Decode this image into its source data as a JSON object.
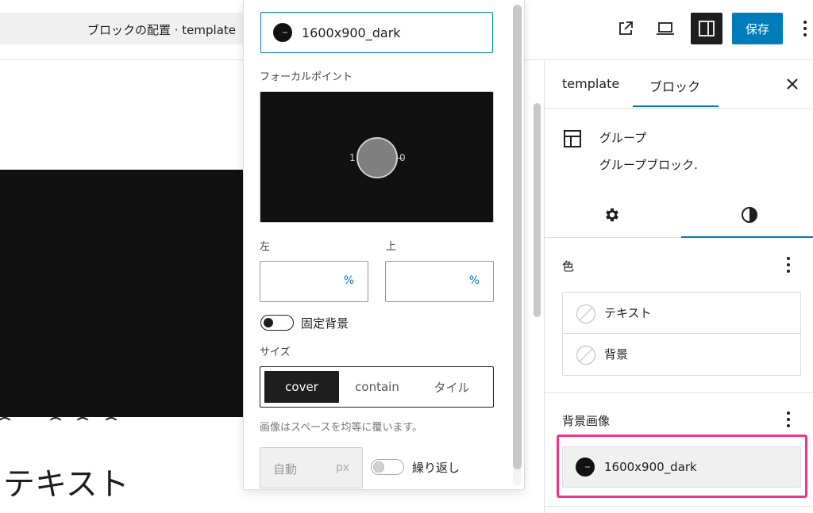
{
  "topbar": {
    "doc_title": "ブロックの配置 · template",
    "save_label": "保存"
  },
  "canvas": {
    "text": "テキスト"
  },
  "popover": {
    "media_label": "1600x900_dark",
    "focal_point_label": "フォーカルポイント",
    "focal_left_marker": "1",
    "focal_right_marker": "0",
    "left_label": "左",
    "top_label": "上",
    "left_value": "",
    "top_value": "",
    "unit_percent": "%",
    "fixed_background_label": "固定背景",
    "size_label": "サイズ",
    "size_options": [
      "cover",
      "contain",
      "タイル"
    ],
    "size_selected": "cover",
    "size_help": "画像はスペースを均等に覆います。",
    "auto_placeholder": "自動",
    "auto_unit": "px",
    "repeat_label": "繰り返し"
  },
  "sidebar": {
    "tabs": [
      "template",
      "ブロック"
    ],
    "active_tab": "ブロック",
    "block_name": "グループ",
    "block_description": "グループブロック.",
    "color_heading": "色",
    "color_items": [
      "テキスト",
      "背景"
    ],
    "background_image_heading": "背景画像",
    "background_image_label": "1600x900_dark"
  },
  "colors": {
    "accent": "#007cba",
    "highlight": "#f0368a",
    "dark": "#1e1e1e"
  }
}
